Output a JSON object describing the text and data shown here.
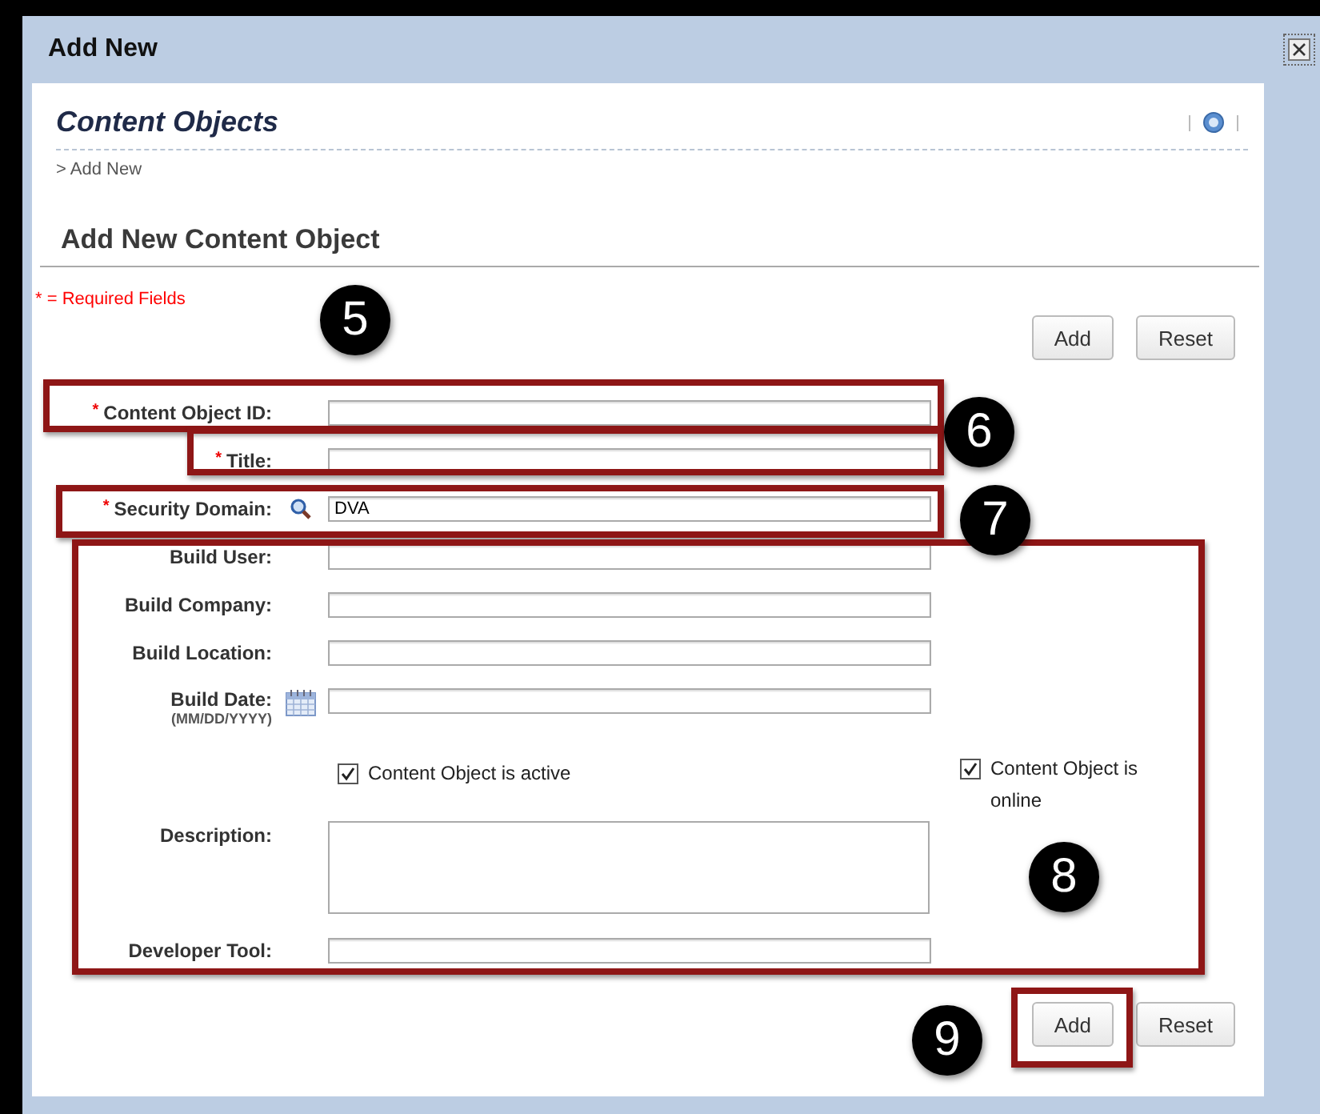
{
  "dialog": {
    "title": "Add New"
  },
  "page": {
    "title": "Content Objects",
    "breadcrumb": "> Add New",
    "heading": "Add New Content Object",
    "required_note": "* = Required Fields"
  },
  "top_buttons": [
    {
      "label": "Add"
    },
    {
      "label": "Reset"
    }
  ],
  "fields": [
    {
      "kind": "text",
      "label": "Content Object ID:",
      "required_mark": "*"
    },
    {
      "kind": "text",
      "label": "Title:",
      "required_mark": "*"
    },
    {
      "kind": "lookup",
      "label": "Security Domain:",
      "required_mark": "*",
      "value": "DVA"
    },
    {
      "kind": "text",
      "label": "Build User:"
    },
    {
      "kind": "text",
      "label": "Build Company:"
    },
    {
      "kind": "text",
      "label": "Build Location:"
    },
    {
      "kind": "date",
      "label": "Build Date:",
      "hint": "(MM/DD/YYYY)"
    },
    {
      "kind": "checks",
      "checks": [
        {
          "label": "Content Object is active",
          "checked": true
        },
        {
          "label": "Content Object is online",
          "checked": true
        }
      ]
    },
    {
      "kind": "textarea",
      "label": "Description:"
    },
    {
      "kind": "text",
      "label": "Developer Tool:"
    }
  ],
  "bottom_buttons": [
    {
      "label": "Add"
    },
    {
      "label": "Reset"
    }
  ],
  "callouts": [
    {
      "number": "5"
    },
    {
      "number": "6"
    },
    {
      "number": "7"
    },
    {
      "number": "8"
    },
    {
      "number": "9"
    }
  ]
}
